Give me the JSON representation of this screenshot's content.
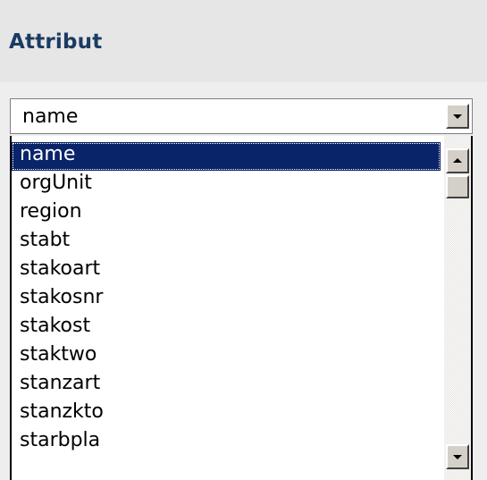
{
  "panel": {
    "title": "Attribut"
  },
  "combo": {
    "value": "name",
    "button_icon": "chevron-down-icon"
  },
  "dropdown": {
    "selected_index": 0,
    "items": [
      "name",
      "orgUnit",
      "region",
      "stabt",
      "stakoart",
      "stakosnr",
      "stakost",
      "staktwo",
      "stanzart",
      "stanzkto",
      "starbpla"
    ],
    "scrollbar": {
      "up_icon": "arrow-up-icon",
      "down_icon": "arrow-down-icon"
    }
  },
  "colors": {
    "title": "#1b3b63",
    "selection": "#0a246a",
    "header_background": "#e6e6e6",
    "button_face": "#d4d0c8"
  }
}
